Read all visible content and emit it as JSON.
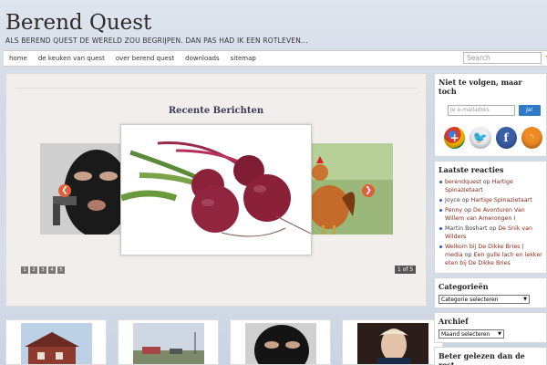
{
  "site": {
    "title": "Berend Quest",
    "tagline": "ALS BEREND QUEST DE WERELD ZOU BEGRIJPEN. DAN PAS HAD IK EEN ROTLEVEN..."
  },
  "nav": {
    "items": [
      "home",
      "de keuken van quest",
      "over berend quest",
      "downloads",
      "sitemap"
    ],
    "search_placeholder": "Search"
  },
  "slider": {
    "heading": "Recente Berichten",
    "pages": [
      "1",
      "2",
      "3",
      "4",
      "5"
    ],
    "count_label": "1 of 5",
    "prev_arrow": "❮",
    "next_arrow": "❯"
  },
  "sidebar": {
    "follow": {
      "title": "Niet te volgen, maar toch",
      "email_placeholder": "Je e-mailadres",
      "submit_label": "Ja!",
      "icons": [
        "google-plus-icon",
        "twitter-icon",
        "facebook-icon",
        "rss-icon"
      ]
    },
    "comments": {
      "title": "Laatste reacties",
      "items": [
        {
          "author": "berendquest",
          "sep": " op ",
          "post": "Hartige Spinazietaart"
        },
        {
          "author": "Joyce",
          "sep": " op ",
          "post": "Hartige Spinazietaart"
        },
        {
          "author": "Penny",
          "sep": " op ",
          "post": "De Avonturen Van Willem van Amerongen I"
        },
        {
          "author": "Martin Boshart",
          "sep": " op ",
          "post": "De Snik van Wilders"
        },
        {
          "author": "Welkom bij De Dikke Bries | media",
          "sep": " op ",
          "post": "Een gulle lach en lekker eten bij De Dikke Bries"
        }
      ]
    },
    "categories": {
      "title": "Categorieën",
      "select": "Categorie selecteren"
    },
    "archive": {
      "title": "Archief",
      "select": "Maand selecteren"
    },
    "better": {
      "title": "Beter gelezen dan de rest.."
    }
  },
  "colors": {
    "accent": "#2e79c9",
    "link": "#8a2a1a",
    "arrow": "#e0603a"
  }
}
